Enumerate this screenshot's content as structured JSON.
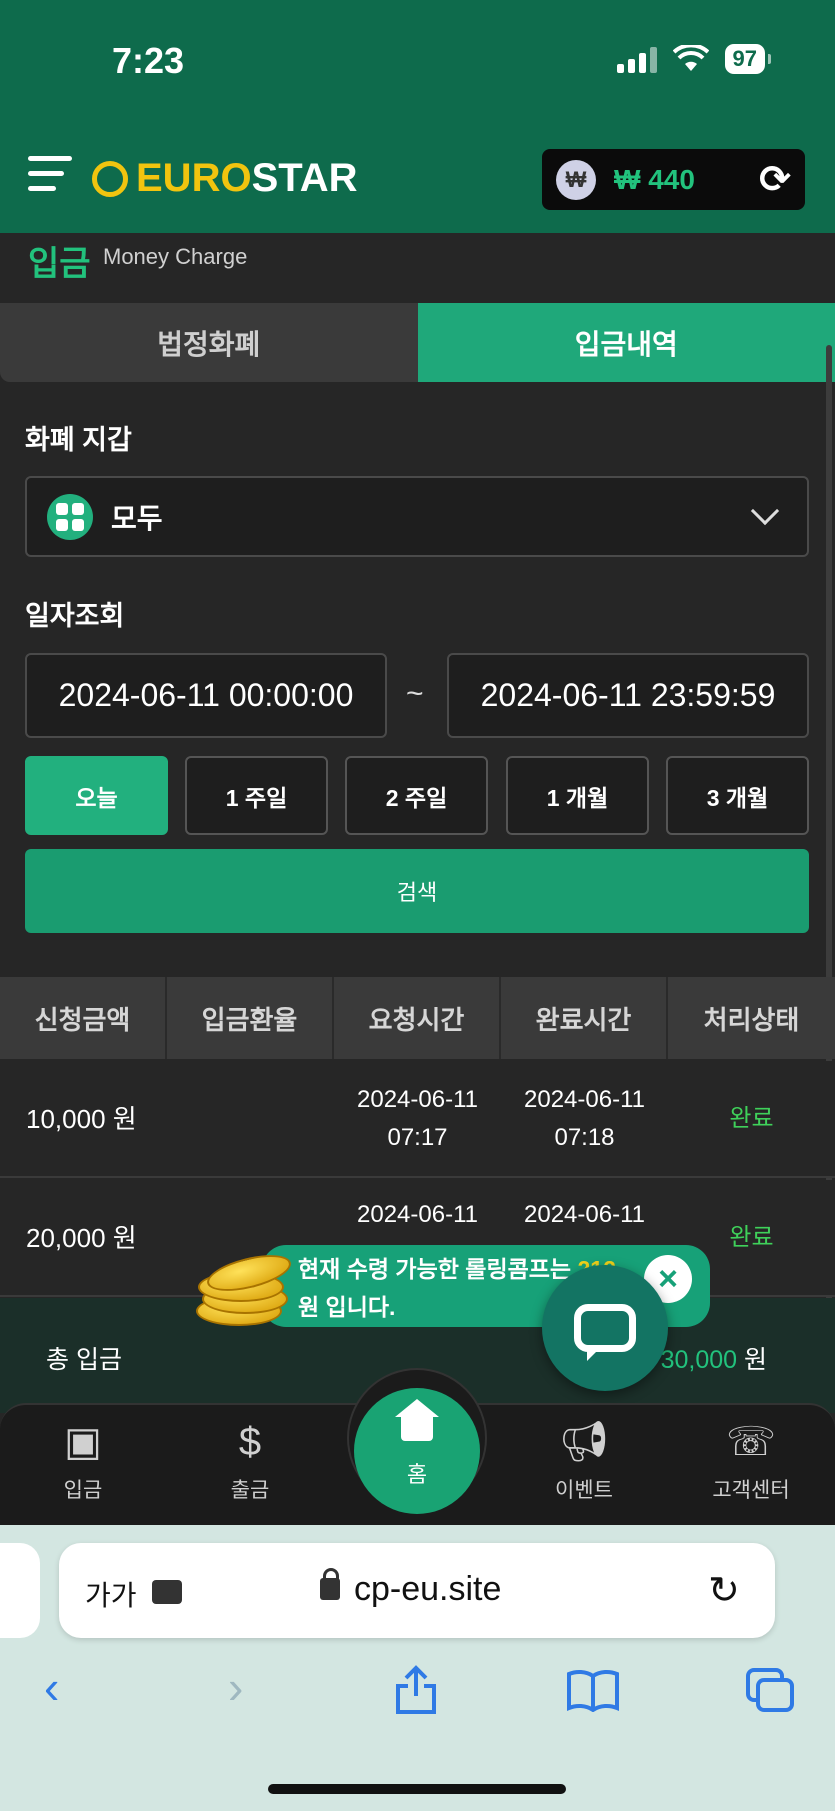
{
  "status_bar": {
    "time": "7:23",
    "battery": "97"
  },
  "header": {
    "logo_euro": "EURO",
    "logo_star": "STAR",
    "currency_symbol": "₩",
    "balance": "₩ 440"
  },
  "page": {
    "title": "입금",
    "subtitle": "Money Charge"
  },
  "tabs": [
    {
      "label": "법정화폐",
      "active": false
    },
    {
      "label": "입금내역",
      "active": true
    }
  ],
  "wallet_section": {
    "label": "화폐 지갑",
    "selected": "모두"
  },
  "date_section": {
    "label": "일자조회",
    "from": "2024-06-11 00:00:00",
    "separator": "~",
    "to": "2024-06-11 23:59:59"
  },
  "periods": [
    {
      "label": "오늘",
      "active": true
    },
    {
      "label": "1 주일",
      "active": false
    },
    {
      "label": "2 주일",
      "active": false
    },
    {
      "label": "1 개월",
      "active": false
    },
    {
      "label": "3 개월",
      "active": false
    }
  ],
  "search_label": "검색",
  "table": {
    "headers": [
      "신청금액",
      "입금환율",
      "요청시간",
      "완료시간",
      "처리상태"
    ],
    "rows": [
      {
        "amount": "10,000 원",
        "rate": "",
        "request_date": "2024-06-11",
        "request_time": "07:17",
        "complete_date": "2024-06-11",
        "complete_time": "07:18",
        "status": "완료"
      },
      {
        "amount": "20,000 원",
        "rate": "",
        "request_date": "2024-06-11",
        "request_time": "",
        "complete_date": "2024-06-11",
        "complete_time": "",
        "status": "완료"
      }
    ]
  },
  "total": {
    "label": "총 입금",
    "value": "30,000",
    "unit": "원"
  },
  "toast": {
    "text_before": "현재 수령 가능한 롤링콤프는 ",
    "highlight": "212",
    "text_after": "원 입니다."
  },
  "bottom_nav": {
    "items": [
      {
        "label": "입금",
        "icon": "deposit-icon"
      },
      {
        "label": "출금",
        "icon": "withdraw-icon"
      },
      {
        "label": "홈",
        "icon": "home-icon"
      },
      {
        "label": "이벤트",
        "icon": "megaphone-icon"
      },
      {
        "label": "고객센터",
        "icon": "support-24-icon"
      }
    ]
  },
  "browser": {
    "text_size": "가가",
    "url": "cp-eu.site"
  },
  "colors": {
    "brand_green": "#0e6b4c",
    "accent": "#22b07e",
    "status_done": "#3fd15a",
    "logo_yellow": "#f1c40f"
  }
}
